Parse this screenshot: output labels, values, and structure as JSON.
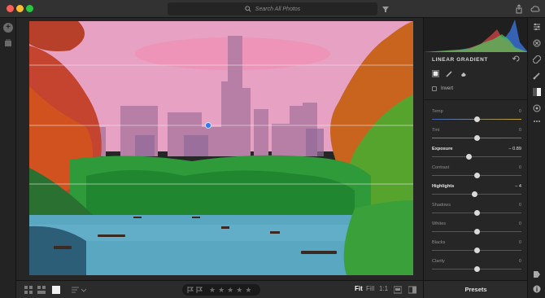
{
  "titlebar": {
    "search_placeholder": "Search All Photos",
    "traffic_colors": [
      "#ff5f57",
      "#febc2e",
      "#28c840"
    ],
    "icons": [
      "search-icon",
      "filter-icon",
      "share-icon",
      "cloud-icon"
    ]
  },
  "left_rail": {
    "add_icon": "+",
    "icons": [
      "add-photos-icon",
      "library-icon"
    ]
  },
  "bottom_bar": {
    "view_icons": [
      "grid-small-icon",
      "grid-large-icon",
      "single-view-icon",
      "sort-icon"
    ],
    "rating_stars": 5,
    "zoom_fit": "Fit",
    "zoom_fill": "Fill",
    "zoom_1to1": "1:1",
    "icons": [
      "compare-icon",
      "before-after-icon"
    ]
  },
  "panel": {
    "title": "LINEAR GRADIENT",
    "invert_label": "Invert",
    "tools": [
      "gradient-tool-icon",
      "brush-tool-icon",
      "eraser-tool-icon"
    ],
    "sliders": [
      {
        "label": "Temp",
        "value": "0",
        "position": 0.5,
        "bright": false
      },
      {
        "label": "Tint",
        "value": "0",
        "position": 0.5,
        "bright": false
      },
      {
        "label": "Exposure",
        "value": "− 0.89",
        "position": 0.41,
        "bright": true
      },
      {
        "label": "Contrast",
        "value": "0",
        "position": 0.5,
        "bright": false
      },
      {
        "label": "Highlights",
        "value": "− 4",
        "position": 0.48,
        "bright": true
      },
      {
        "label": "Shadows",
        "value": "0",
        "position": 0.5,
        "bright": false
      },
      {
        "label": "Whites",
        "value": "0",
        "position": 0.5,
        "bright": false
      },
      {
        "label": "Blacks",
        "value": "0",
        "position": 0.5,
        "bright": false
      },
      {
        "label": "Clarity",
        "value": "0",
        "position": 0.5,
        "bright": false
      }
    ],
    "presets_label": "Presets"
  },
  "right_rail": {
    "icons": [
      "sliders-icon",
      "crop-icon",
      "healing-icon",
      "brush-icon",
      "linear-gradient-icon",
      "radial-gradient-icon",
      "more-icon",
      "tag-icon",
      "info-icon"
    ]
  },
  "colors": {
    "accent": "#ffffff",
    "mask_overlay": "#e0509f",
    "pin": "#2f7cf0"
  }
}
